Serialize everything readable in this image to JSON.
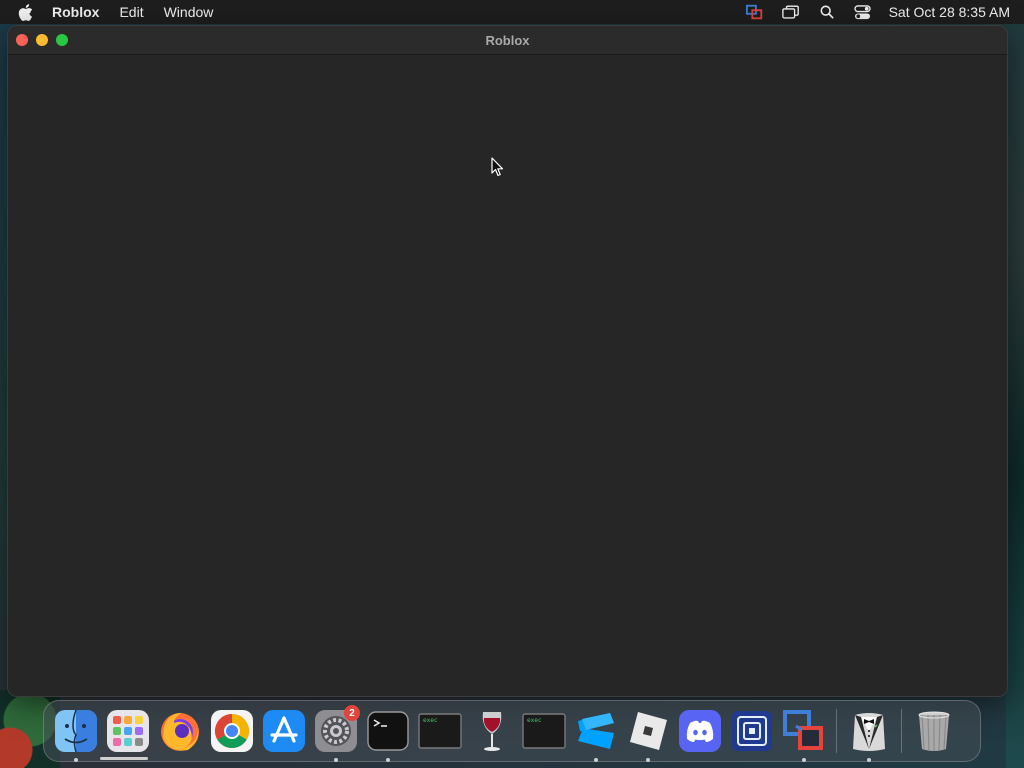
{
  "menubar": {
    "app_name": "Roblox",
    "menus": [
      "Edit",
      "Window"
    ],
    "clock": "Sat Oct 28  8:35 AM"
  },
  "window": {
    "title": "Roblox"
  },
  "dock": {
    "items": [
      {
        "name": "finder",
        "running": true
      },
      {
        "name": "launchpad",
        "running": false
      },
      {
        "name": "firefox",
        "running": false
      },
      {
        "name": "chrome",
        "running": false
      },
      {
        "name": "app-store",
        "running": false
      },
      {
        "name": "system-settings",
        "running": true,
        "badge": "2"
      },
      {
        "name": "terminal",
        "running": true
      },
      {
        "name": "exec-1",
        "label": "exec",
        "running": false
      },
      {
        "name": "wine",
        "running": false
      },
      {
        "name": "exec-2",
        "label": "exec",
        "running": false
      },
      {
        "name": "roblox-studio",
        "running": true
      },
      {
        "name": "roblox",
        "running": true
      },
      {
        "name": "discord",
        "running": false
      },
      {
        "name": "app-square",
        "running": false
      },
      {
        "name": "vm-app",
        "running": true
      },
      {
        "name": "bartender",
        "running": true
      },
      {
        "name": "trash",
        "running": false
      }
    ]
  },
  "colors": {
    "close": "#fe5f57",
    "minimize": "#febc2e",
    "maximize": "#28c840",
    "badge": "#e0443a"
  }
}
